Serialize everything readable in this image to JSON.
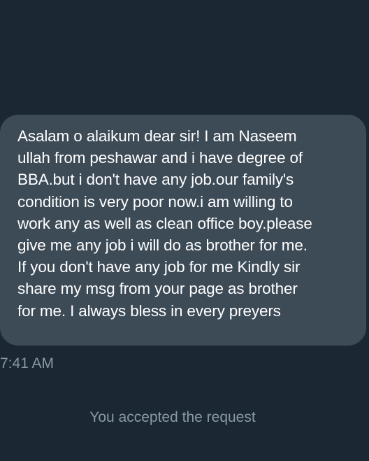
{
  "conversation": {
    "message": {
      "text": "Asalam o alaikum dear sir! I am Naseem\nullah from peshawar and i have degree of\nBBA.but i don't have any job.our family's\ncondition is very poor now.i am willing to\nwork any as well as clean office boy.please\ngive me any job i will do as brother for me.\nIf you don't have any job for me Kindly sir\nshare my msg from your page as brother\nfor me. I always bless in every preyers",
      "time": "7:41 AM"
    },
    "system_notice": "You accepted the request"
  },
  "colors": {
    "background": "#1b2732",
    "bubble": "#3d4b57",
    "message_text": "#ffffff",
    "secondary_text": "#8899a6"
  }
}
